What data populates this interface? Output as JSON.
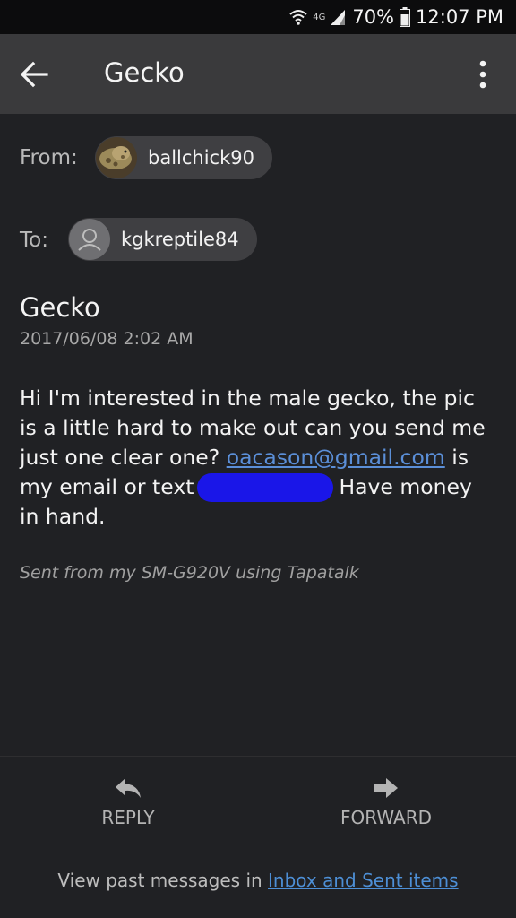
{
  "status_bar": {
    "network": "4G",
    "battery": "70%",
    "time": "12:07 PM"
  },
  "app_bar": {
    "title": "Gecko",
    "back_icon": "arrow-back-icon",
    "menu_icon": "more-vert-icon"
  },
  "from": {
    "label": "From:",
    "name": "ballchick90"
  },
  "to": {
    "label": "To:",
    "name": "kgkreptile84"
  },
  "message": {
    "subject": "Gecko",
    "date": "2017/06/08 2:02 AM",
    "body_part1": "Hi I'm interested in the male gecko, the pic is a little hard to make out can you send me just one clear one?",
    "email": "oacason@gmail.com",
    "body_part2": "is my email or text",
    "body_part3": "Have money in hand.",
    "signature": "Sent from my SM-G920V using Tapatalk"
  },
  "actions": {
    "reply": "REPLY",
    "forward": "FORWARD"
  },
  "footer": {
    "prefix": "View past messages in",
    "link": "Inbox and Sent items"
  },
  "colors": {
    "background": "#202124",
    "app_bar": "#3a3a3c",
    "link": "#5b8fd8",
    "redaction": "#1a16e8"
  }
}
